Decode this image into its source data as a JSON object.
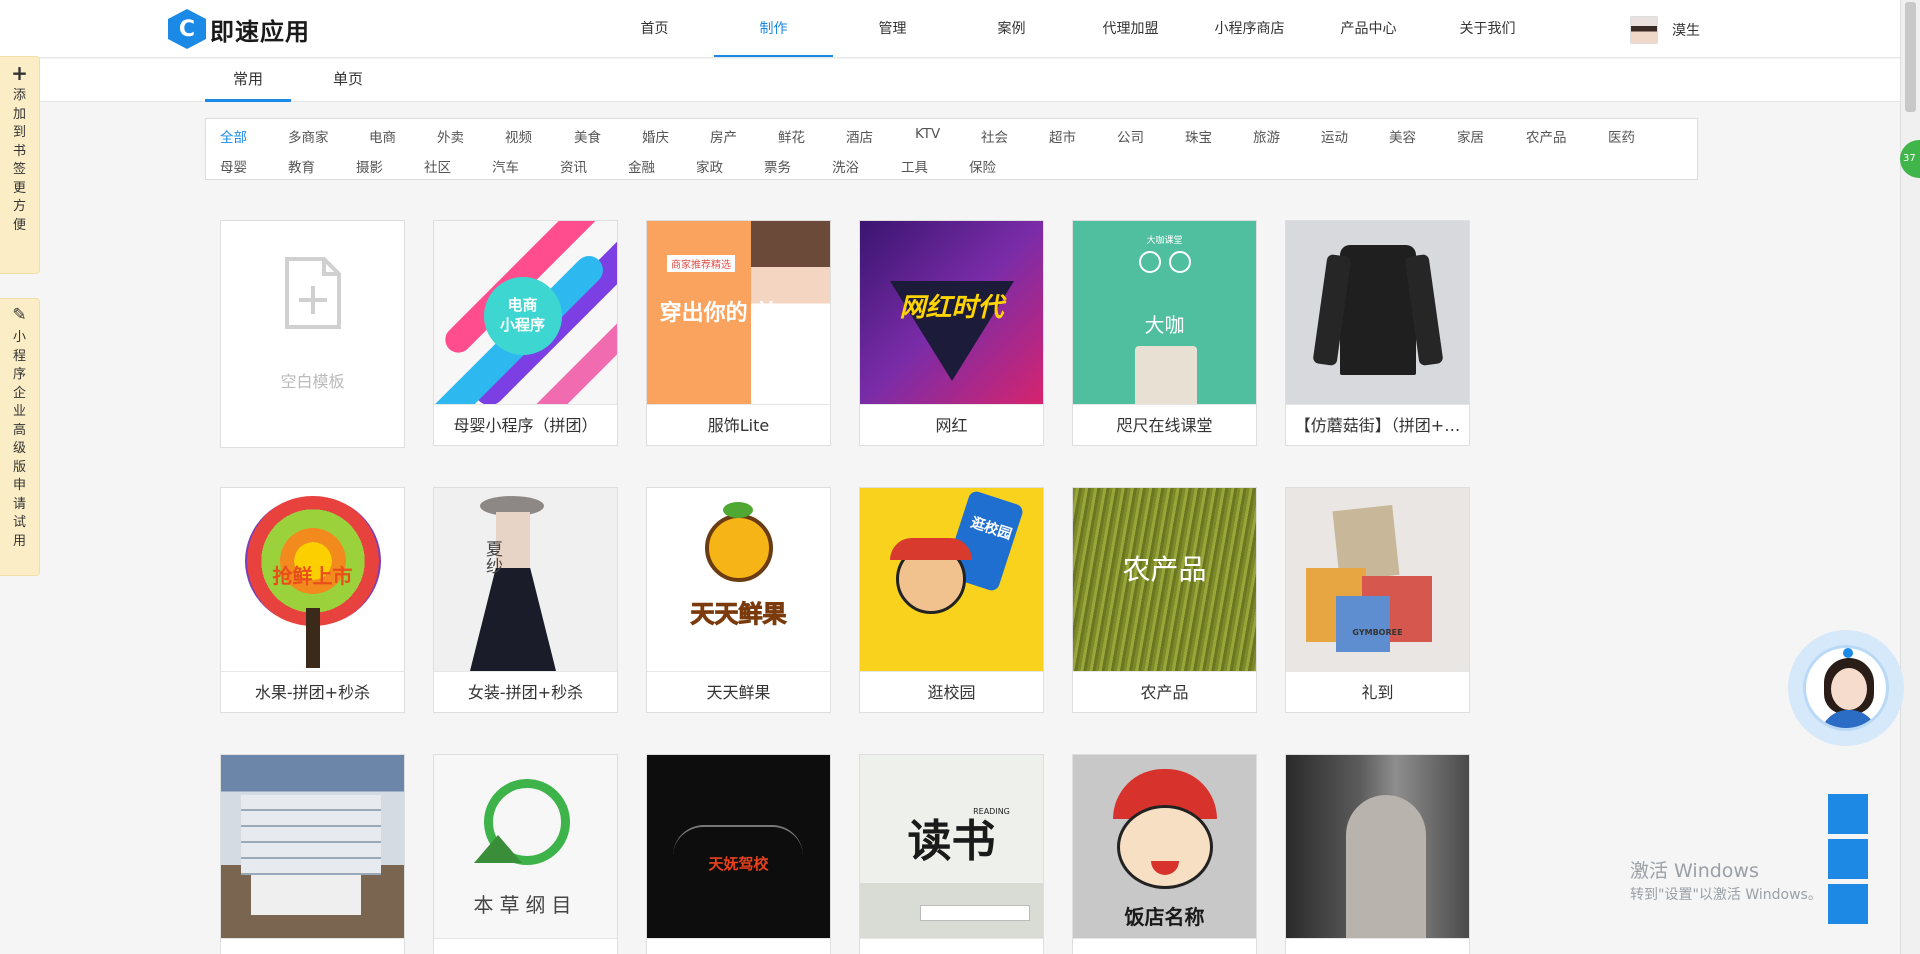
{
  "header": {
    "logo_mark": "C",
    "logo_text": "即速应用",
    "nav": [
      {
        "label": "首页",
        "active": false
      },
      {
        "label": "制作",
        "active": true
      },
      {
        "label": "管理",
        "active": false
      },
      {
        "label": "案例",
        "active": false
      },
      {
        "label": "代理加盟",
        "active": false
      },
      {
        "label": "小程序商店",
        "active": false
      },
      {
        "label": "产品中心",
        "active": false
      },
      {
        "label": "关于我们",
        "active": false
      }
    ],
    "username": "漠生"
  },
  "subtabs": [
    {
      "label": "常用",
      "active": true
    },
    {
      "label": "单页",
      "active": false
    }
  ],
  "side_tabs": [
    {
      "glyph": "+",
      "text": "添加到书签更方便"
    },
    {
      "glyph": "✎",
      "text": "小程序企业高级版申请试用"
    }
  ],
  "categories_row1": [
    "全部",
    "多商家",
    "电商",
    "外卖",
    "视频",
    "美食",
    "婚庆",
    "房产",
    "鲜花",
    "酒店",
    "KTV",
    "社会",
    "超市",
    "公司",
    "珠宝",
    "旅游",
    "运动",
    "美容",
    "家居",
    "农产品",
    "医药"
  ],
  "categories_row2": [
    "母婴",
    "教育",
    "摄影",
    "社区",
    "汽车",
    "资讯",
    "金融",
    "家政",
    "票务",
    "洗浴",
    "工具",
    "保险"
  ],
  "active_category": "全部",
  "blank_template": {
    "label": "空白模板"
  },
  "templates_row1": [
    {
      "name": "母婴小程序（拼团）",
      "art": "电商\n小程序"
    },
    {
      "name": "服饰Lite",
      "art": "穿出你的 美",
      "tag": "商家推荐精选"
    },
    {
      "name": "网红",
      "art": "网红时代"
    },
    {
      "name": "咫尺在线课堂",
      "art": "大咖",
      "tag": "大咖课堂"
    },
    {
      "name": "【仿蘑菇街】（拼团+…",
      "art": ""
    }
  ],
  "templates_row2": [
    {
      "name": "水果-拼团+秒杀",
      "art": "抢鲜上市"
    },
    {
      "name": "女装-拼团+秒杀",
      "art": "夏纱"
    },
    {
      "name": "天天鲜果",
      "art": "天天鲜果"
    },
    {
      "name": "逛校园",
      "art": "逛校园"
    },
    {
      "name": "农产品",
      "art": "农产品"
    },
    {
      "name": "礼到",
      "art": "GYMBOREE"
    }
  ],
  "templates_row3": [
    {
      "name": "",
      "art": ""
    },
    {
      "name": "",
      "art": "本草纲目"
    },
    {
      "name": "",
      "art": "天妩驾校"
    },
    {
      "name": "",
      "art": "读书",
      "tag": "READING"
    },
    {
      "name": "",
      "art": "饭店名称"
    },
    {
      "name": "",
      "art": ""
    }
  ],
  "right_widgets": {
    "badge": "37"
  },
  "watermark": {
    "line1": "激活 Windows",
    "line2": "转到\"设置\"以激活 Windows。"
  },
  "colors": {
    "accent": "#1a8ae6",
    "side_tab_bg": "#fbeec7"
  }
}
